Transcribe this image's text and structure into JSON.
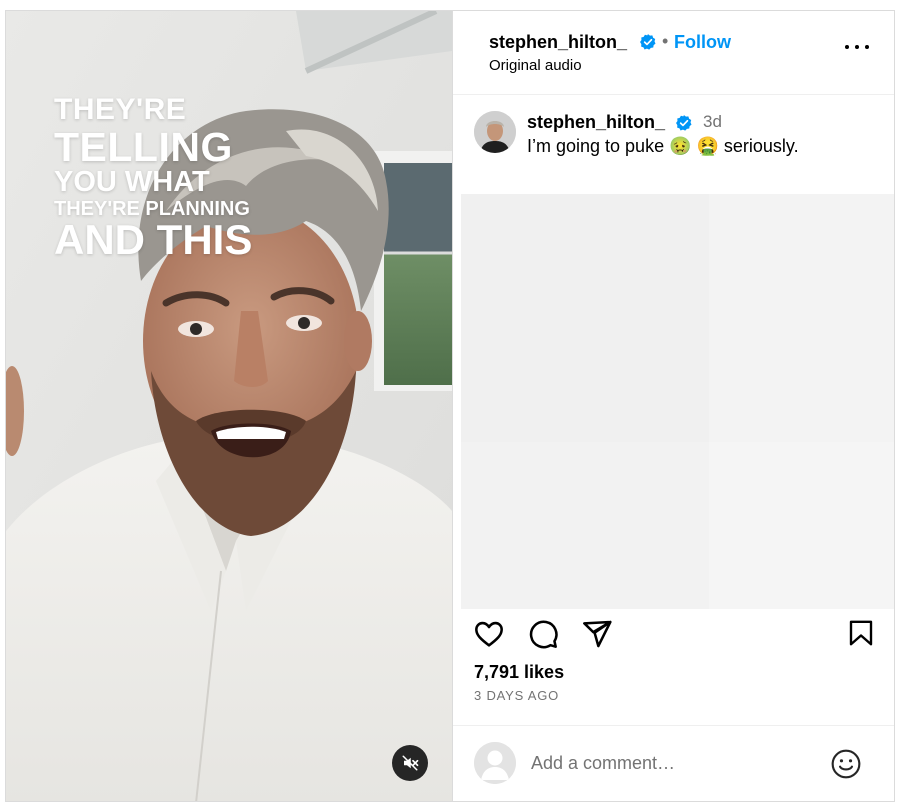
{
  "video": {
    "overlay_lines": [
      "THEY'RE",
      "TELLING",
      "YOU WHAT",
      "THEY'RE PLANNING",
      "AND THIS"
    ]
  },
  "header": {
    "username": "stephen_hilton_",
    "separator": "•",
    "follow_label": "Follow",
    "audio_label": "Original audio"
  },
  "caption": {
    "username": "stephen_hilton_",
    "time": "3d",
    "text": "I’m going to puke 🤢 🤮 seriously."
  },
  "post": {
    "likes": "7,791 likes",
    "posted_ago": "3 DAYS AGO"
  },
  "comment": {
    "placeholder": "Add a comment…"
  },
  "colors": {
    "accent": "#0095f6",
    "verified": "#0095f6",
    "muted_text": "#737373",
    "mute_button": "#262626"
  },
  "icons": [
    "verified-badge-icon",
    "more-options-icon",
    "heart-icon",
    "comment-icon",
    "share-icon",
    "bookmark-icon",
    "emoji-icon",
    "mute-icon"
  ]
}
